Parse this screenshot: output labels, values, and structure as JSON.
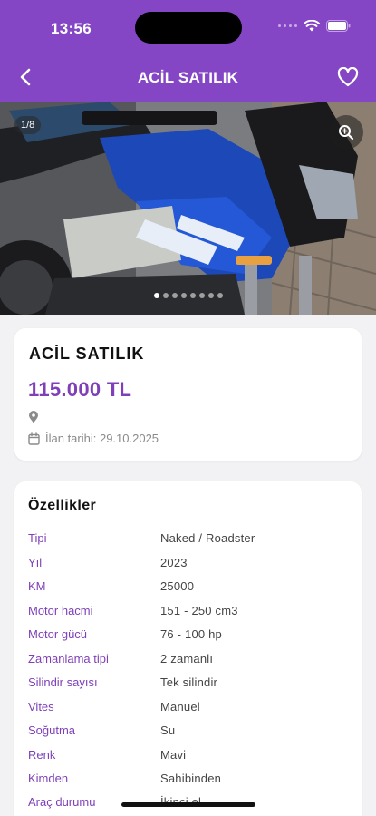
{
  "status_bar": {
    "time": "13:56"
  },
  "app_bar": {
    "title": "ACİL SATILIK"
  },
  "gallery": {
    "counter": "1/8",
    "photo_count": 8,
    "current_index": 0
  },
  "listing": {
    "title": "ACİL SATILIK",
    "price": "115.000 TL",
    "date_label": "İlan tarihi: 29.10.2025"
  },
  "specs": {
    "heading": "Özellikler",
    "rows": [
      {
        "key": "Tipi",
        "value": "Naked / Roadster"
      },
      {
        "key": "Yıl",
        "value": "2023"
      },
      {
        "key": "KM",
        "value": "25000"
      },
      {
        "key": "Motor hacmi",
        "value": "151 - 250 cm3"
      },
      {
        "key": "Motor gücü",
        "value": "76 - 100 hp"
      },
      {
        "key": "Zamanlama tipi",
        "value": "2 zamanlı"
      },
      {
        "key": "Silindir sayısı",
        "value": "Tek silindir"
      },
      {
        "key": "Vites",
        "value": "Manuel"
      },
      {
        "key": "Soğutma",
        "value": "Su"
      },
      {
        "key": "Renk",
        "value": "Mavi"
      },
      {
        "key": "Kimden",
        "value": "Sahibinden"
      },
      {
        "key": "Araç durumu",
        "value": "İkinci el"
      }
    ]
  },
  "colors": {
    "brand": "#8446c4",
    "accent_text": "#7e3fb8"
  },
  "icons": [
    "back-arrow-icon",
    "heart-icon",
    "zoom-in-icon",
    "location-pin-icon",
    "calendar-icon",
    "wifi-icon",
    "battery-icon"
  ]
}
